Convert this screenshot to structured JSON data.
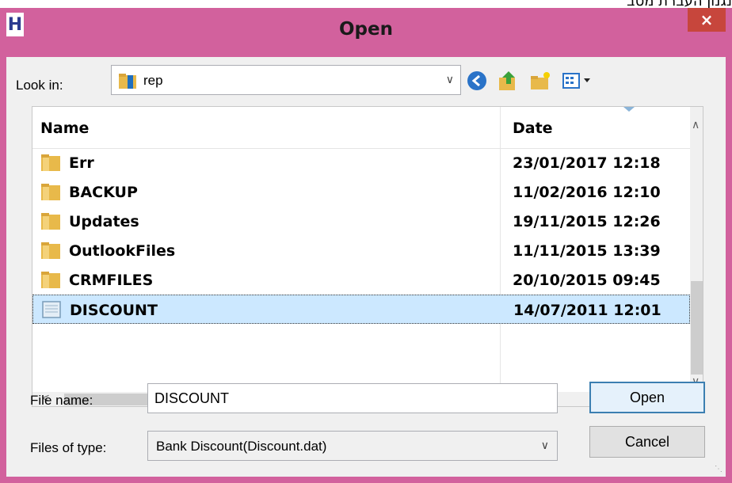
{
  "background_text": "נגנון העברת מסב",
  "window": {
    "title": "Open",
    "app_icon": "H",
    "close": "×"
  },
  "lookin": {
    "label": "Look in:",
    "value": "rep"
  },
  "toolbar": {
    "back_icon": "back-arrow-icon",
    "up_icon": "up-folder-icon",
    "newfolder_icon": "new-folder-icon",
    "view_icon": "view-menu-icon"
  },
  "columns": {
    "name": "Name",
    "date": "Date"
  },
  "files": [
    {
      "name": "Err",
      "date": "23/01/2017 12:18",
      "type": "folder"
    },
    {
      "name": "BACKUP",
      "date": "11/02/2016 12:10",
      "type": "folder"
    },
    {
      "name": "Updates",
      "date": "19/11/2015 12:26",
      "type": "folder"
    },
    {
      "name": "OutlookFiles",
      "date": "11/11/2015 13:39",
      "type": "folder"
    },
    {
      "name": "CRMFILES",
      "date": "20/10/2015 09:45",
      "type": "folder"
    },
    {
      "name": "DISCOUNT",
      "date": "14/07/2011 12:01",
      "type": "file",
      "selected": true
    }
  ],
  "filename": {
    "label": "File name:",
    "value": "DISCOUNT"
  },
  "filetype": {
    "label": "Files of type:",
    "value": "Bank Discount(Discount.dat)"
  },
  "buttons": {
    "open": "Open",
    "cancel": "Cancel"
  },
  "colors": {
    "title_bar": "#d2619d",
    "close_button": "#c7463c",
    "selection": "#cce8ff"
  }
}
